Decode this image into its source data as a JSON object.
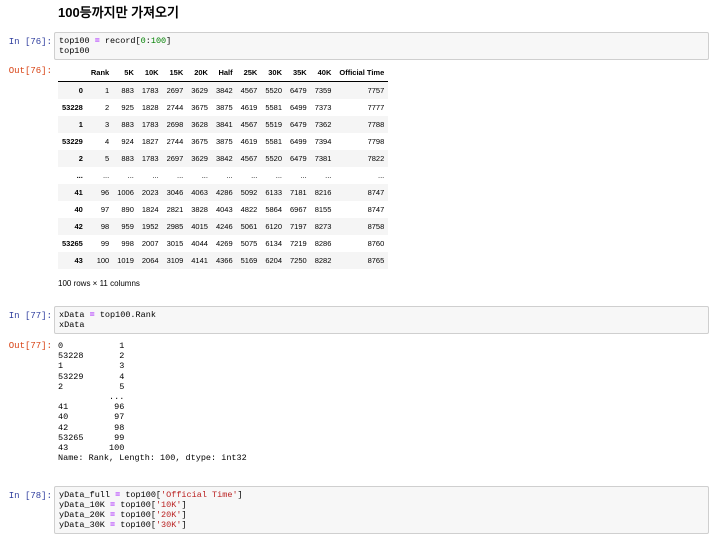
{
  "heading": "100등까지만 가져오기",
  "cells": {
    "c76": {
      "in_prompt": "In [76]:",
      "out_prompt": "Out[76]:",
      "code": [
        [
          {
            "t": "top100 ",
            "c": "kw"
          },
          {
            "t": "=",
            "c": "op"
          },
          {
            "t": " record[",
            "c": "kw"
          },
          {
            "t": "0",
            "c": "num"
          },
          {
            "t": ":",
            "c": "kw"
          },
          {
            "t": "100",
            "c": "num"
          },
          {
            "t": "]",
            "c": "kw"
          }
        ],
        [
          {
            "t": "top100",
            "c": "kw"
          }
        ]
      ]
    },
    "c77": {
      "in_prompt": "In [77]:",
      "out_prompt": "Out[77]:",
      "code": [
        [
          {
            "t": "xData ",
            "c": "kw"
          },
          {
            "t": "=",
            "c": "op"
          },
          {
            "t": " top100.Rank",
            "c": "kw"
          }
        ],
        [
          {
            "t": "xData",
            "c": "kw"
          }
        ]
      ],
      "output_lines": [
        "0           1",
        "53228       2",
        "1           3",
        "53229       4",
        "2           5",
        "          ...",
        "41         96",
        "40         97",
        "42         98",
        "53265      99",
        "43        100",
        "Name: Rank, Length: 100, dtype: int32"
      ]
    },
    "c78": {
      "in_prompt": "In [78]:",
      "code": [
        [
          {
            "t": "yData_full ",
            "c": "kw"
          },
          {
            "t": "=",
            "c": "op"
          },
          {
            "t": " top100[",
            "c": "kw"
          },
          {
            "t": "'Official Time'",
            "c": "str"
          },
          {
            "t": "]",
            "c": "kw"
          }
        ],
        [
          {
            "t": "yData_10K ",
            "c": "kw"
          },
          {
            "t": "=",
            "c": "op"
          },
          {
            "t": " top100[",
            "c": "kw"
          },
          {
            "t": "'10K'",
            "c": "str"
          },
          {
            "t": "]",
            "c": "kw"
          }
        ],
        [
          {
            "t": "yData_20K ",
            "c": "kw"
          },
          {
            "t": "=",
            "c": "op"
          },
          {
            "t": " top100[",
            "c": "kw"
          },
          {
            "t": "'20K'",
            "c": "str"
          },
          {
            "t": "]",
            "c": "kw"
          }
        ],
        [
          {
            "t": "yData_30K ",
            "c": "kw"
          },
          {
            "t": "=",
            "c": "op"
          },
          {
            "t": " top100[",
            "c": "kw"
          },
          {
            "t": "'30K'",
            "c": "str"
          },
          {
            "t": "]",
            "c": "kw"
          }
        ]
      ]
    }
  },
  "dataframe": {
    "columns": [
      "",
      "Rank",
      "5K",
      "10K",
      "15K",
      "20K",
      "Half",
      "25K",
      "30K",
      "35K",
      "40K",
      "Official Time"
    ],
    "rows": [
      [
        "0",
        "1",
        "883",
        "1783",
        "2697",
        "3629",
        "3842",
        "4567",
        "5520",
        "6479",
        "7359",
        "7757"
      ],
      [
        "53228",
        "2",
        "925",
        "1828",
        "2744",
        "3675",
        "3875",
        "4619",
        "5581",
        "6499",
        "7373",
        "7777"
      ],
      [
        "1",
        "3",
        "883",
        "1783",
        "2698",
        "3628",
        "3841",
        "4567",
        "5519",
        "6479",
        "7362",
        "7788"
      ],
      [
        "53229",
        "4",
        "924",
        "1827",
        "2744",
        "3675",
        "3875",
        "4619",
        "5581",
        "6499",
        "7394",
        "7798"
      ],
      [
        "2",
        "5",
        "883",
        "1783",
        "2697",
        "3629",
        "3842",
        "4567",
        "5520",
        "6479",
        "7381",
        "7822"
      ],
      [
        "...",
        "...",
        "...",
        "...",
        "...",
        "...",
        "...",
        "...",
        "...",
        "...",
        "...",
        "..."
      ],
      [
        "41",
        "96",
        "1006",
        "2023",
        "3046",
        "4063",
        "4286",
        "5092",
        "6133",
        "7181",
        "8216",
        "8747"
      ],
      [
        "40",
        "97",
        "890",
        "1824",
        "2821",
        "3828",
        "4043",
        "4822",
        "5864",
        "6967",
        "8155",
        "8747"
      ],
      [
        "42",
        "98",
        "959",
        "1952",
        "2985",
        "4015",
        "4246",
        "5061",
        "6120",
        "7197",
        "8273",
        "8758"
      ],
      [
        "53265",
        "99",
        "998",
        "2007",
        "3015",
        "4044",
        "4269",
        "5075",
        "6134",
        "7219",
        "8286",
        "8760"
      ],
      [
        "43",
        "100",
        "1019",
        "2064",
        "3109",
        "4141",
        "4366",
        "5169",
        "6204",
        "7250",
        "8282",
        "8765"
      ]
    ],
    "summary": "100 rows × 11 columns"
  }
}
